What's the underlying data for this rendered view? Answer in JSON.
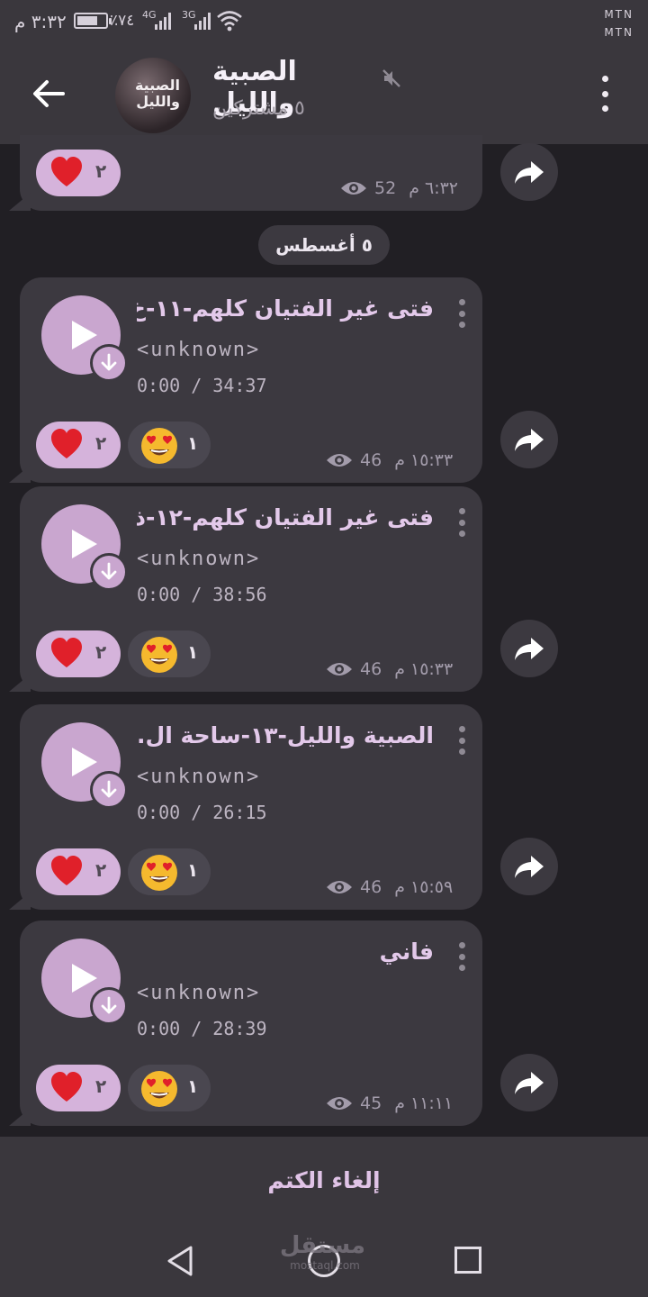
{
  "status_bar": {
    "time": "٣:٣٢ م",
    "battery_pct": "٪٧٤",
    "battery_level": 0.74,
    "net1": "4G",
    "net2": "3G",
    "carrier1": "MTN",
    "carrier2": "MTN"
  },
  "header": {
    "title": "الصبية والليل",
    "subtitle": "٥ مشتركين",
    "avatar_text": "الصبية والليل"
  },
  "top_message": {
    "heart_count": "٢",
    "views": "52",
    "time": "٦:٣٢ م"
  },
  "date_separator": "٥ أغسطس",
  "messages": [
    {
      "title": "فتى غير الفتيان كلهم-١١-خ...",
      "performer": "<unknown>",
      "duration": "0:00 / 34:37",
      "heart_count": "٢",
      "eyes_count": "١",
      "views": "46",
      "time": "١٥:٣٣ م"
    },
    {
      "title": "فتى غير الفتيان كلهم-١٢-ذ...",
      "performer": "<unknown>",
      "duration": "0:00 / 38:56",
      "heart_count": "٢",
      "eyes_count": "١",
      "views": "46",
      "time": "١٥:٣٣ م"
    },
    {
      "title": "الصبية والليل-١٣-ساحة ال...",
      "performer": "<unknown>",
      "duration": "0:00 / 26:15",
      "heart_count": "٢",
      "eyes_count": "١",
      "views": "46",
      "time": "١٥:٥٩ م"
    },
    {
      "title": "فاني",
      "performer": "<unknown>",
      "duration": "0:00 / 28:39",
      "heart_count": "٢",
      "eyes_count": "١",
      "views": "45",
      "time": "١١:١١ م"
    }
  ],
  "unmute_label": "إلغاء الكتم",
  "watermark": {
    "line1": "مستقل",
    "line2": "mostaql.com"
  },
  "colors": {
    "background": "#211f24",
    "bubble": "#3c3940",
    "accent": "#c9a6cf",
    "title_text": "#e3c9ea",
    "heart": "#e0202a"
  },
  "icons": [
    "back-arrow-icon",
    "mute-icon",
    "more-vert-icon",
    "play-icon",
    "download-icon",
    "heart-icon",
    "heart-eyes-icon",
    "eye-icon",
    "forward-icon"
  ]
}
